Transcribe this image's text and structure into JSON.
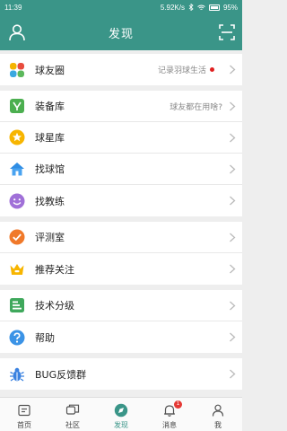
{
  "status_bar": {
    "time": "11:39",
    "network_speed": "5.92K/s",
    "battery": "95%"
  },
  "header": {
    "title": "发现"
  },
  "groups": [
    {
      "items": [
        {
          "label": "球友圈",
          "subtitle": "记录羽球生活",
          "has_dot": true,
          "icon": "colorful-petals-icon"
        }
      ]
    },
    {
      "items": [
        {
          "label": "装备库",
          "subtitle": "球友都在用啥?",
          "icon": "racket-box-icon"
        },
        {
          "label": "球星库",
          "icon": "star-icon"
        },
        {
          "label": "找球馆",
          "icon": "house-icon"
        },
        {
          "label": "找教练",
          "icon": "smiley-icon"
        }
      ]
    },
    {
      "items": [
        {
          "label": "评测室",
          "icon": "check-circle-icon"
        },
        {
          "label": "推荐关注",
          "icon": "crown-icon"
        }
      ]
    },
    {
      "items": [
        {
          "label": "技术分级",
          "icon": "level-list-icon"
        },
        {
          "label": "帮助",
          "icon": "help-icon"
        }
      ]
    },
    {
      "items": [
        {
          "label": "BUG反馈群",
          "icon": "bug-icon"
        }
      ]
    }
  ],
  "tabs": [
    {
      "label": "首页",
      "icon": "home-icon"
    },
    {
      "label": "社区",
      "icon": "community-icon"
    },
    {
      "label": "发现",
      "icon": "discover-icon",
      "active": true
    },
    {
      "label": "消息",
      "icon": "bell-icon",
      "badge": "1"
    },
    {
      "label": "我",
      "icon": "person-icon"
    }
  ],
  "colors": {
    "primary": "#3a9588",
    "dot_red": "#e02020"
  }
}
